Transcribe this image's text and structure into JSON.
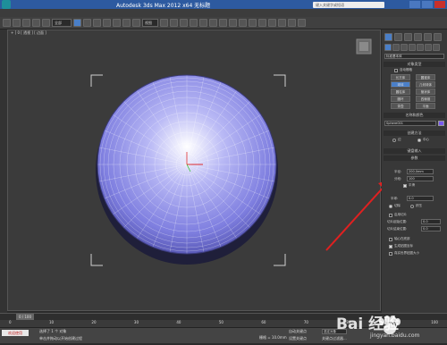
{
  "window": {
    "title": "Autodesk 3ds Max 2012 x64   无标题",
    "controls": [
      "minimize",
      "maximize",
      "close"
    ]
  },
  "toolbar": {
    "filter_dropdown": "全部",
    "view_dropdown": "视图",
    "search_placeholder": "键入关键字或短语"
  },
  "viewport": {
    "label": "+ ] 0 [ 透视 ] [ 边面 ]"
  },
  "command_panel": {
    "category_dropdown": "标准基本体",
    "object_type_header": "对象类型",
    "autogrid_label": "自动栅格",
    "object_buttons": [
      "长方体",
      "圆锥体",
      "球体",
      "几何球体",
      "圆柱体",
      "管状体",
      "圆环",
      "四棱锥",
      "茶壶",
      "平面"
    ],
    "name_color_header": "名称和颜色",
    "object_name": "Sphere001",
    "creation_method_header": "创建方法",
    "creation_options": [
      "边",
      "中心"
    ],
    "keyboard_entry_header": "键盘输入",
    "params_header": "参数",
    "radius_label": "半径:",
    "radius_value": "200.0mm",
    "segments_label": "分段:",
    "segments_value": "100",
    "smooth_label": "平滑",
    "hemisphere_label": "半球:",
    "hemisphere_value": "0.0",
    "chop_label": "切除",
    "squash_label": "挤压",
    "slice_on_label": "启用切片",
    "slice_from_label": "切片起始位置:",
    "slice_from_value": "0.0",
    "slice_to_label": "切片结束位置:",
    "slice_to_value": "0.0",
    "base_to_pivot_label": "轴心在底部",
    "gen_mapping_label": "生成贴图坐标",
    "real_world_label": "真实世界贴图大小"
  },
  "timeline": {
    "frame_label": "0 / 100",
    "ticks": [
      "0",
      "10",
      "20",
      "30",
      "40",
      "50",
      "60",
      "70",
      "80",
      "90",
      "100"
    ]
  },
  "status": {
    "selected_text": "选择了 1 个 对象",
    "prompt_text": "单击并拖动以开始创建过程",
    "welcome_button": "欢迎使用",
    "grid_text": "栅格 = 10.0mm",
    "auto_key_label": "自动关键点",
    "set_key_label": "设置关键点",
    "selection_dropdown": "选定对象",
    "key_filter_label": "关键点过滤器..."
  },
  "annotation": {
    "accent": "#e02020"
  },
  "watermark": {
    "brand": "Bai 经验",
    "url": "jingyan.baidu.com"
  }
}
